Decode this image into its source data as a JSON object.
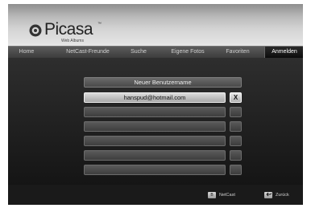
{
  "app": {
    "logo_text": "Picasa",
    "logo_tm": "™",
    "logo_subtitle": "Web Albums",
    "logo_colors": [
      "#2f6ed1",
      "#e2302c",
      "#f4b400",
      "#1a9c3d"
    ]
  },
  "nav": {
    "items": [
      {
        "label": "Home"
      },
      {
        "label": "NetCast-Freunde"
      },
      {
        "label": "Suche"
      },
      {
        "label": "Eigene Fotos"
      },
      {
        "label": "Favoriten"
      },
      {
        "label": "Anmelden"
      }
    ],
    "active_index": 5
  },
  "login": {
    "title_label": "Neuer Benutzername",
    "rows": [
      {
        "value": "hanspud@hotmail.com",
        "remove_label": "X"
      },
      {
        "value": ""
      },
      {
        "value": ""
      },
      {
        "value": ""
      },
      {
        "value": ""
      },
      {
        "value": ""
      }
    ]
  },
  "footer": {
    "netcast_key": "B",
    "netcast_label": "NetCast",
    "back_label": "Zurück",
    "back_icon": "return-arrow-icon"
  }
}
